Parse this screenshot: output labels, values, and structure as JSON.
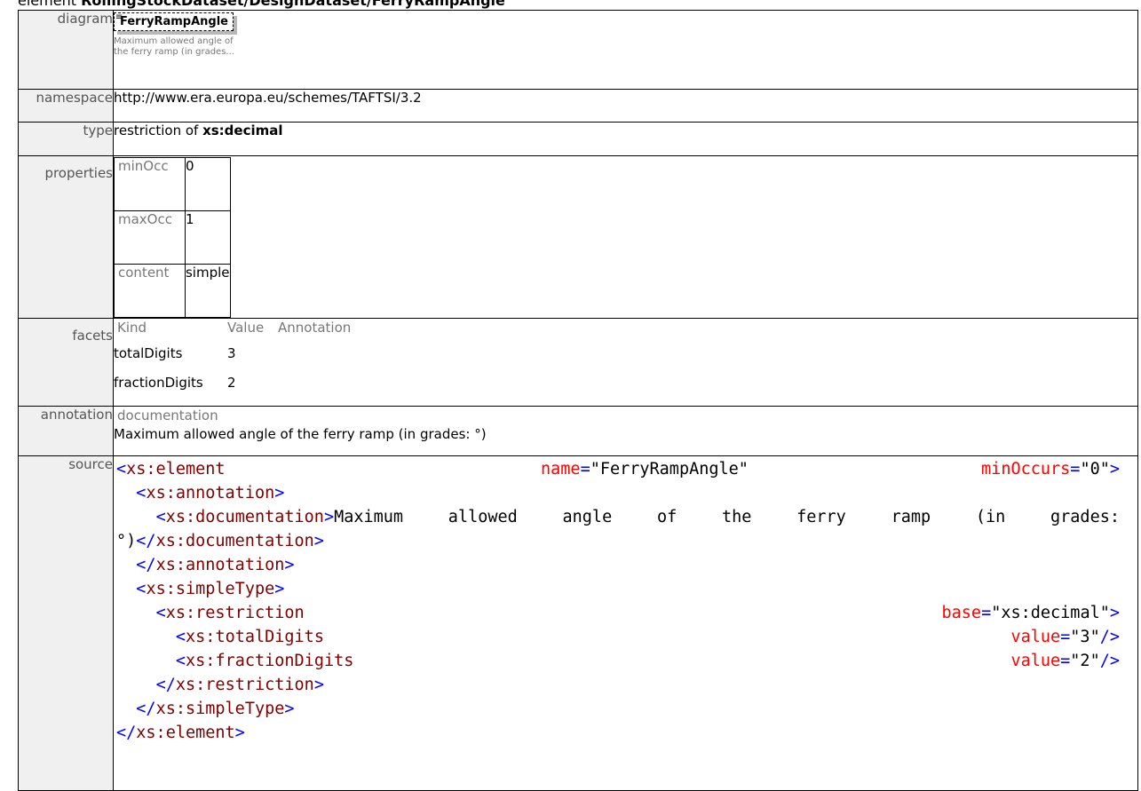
{
  "title": {
    "prefix": "element ",
    "path": "RollingStockDataset/DesignDataset/FerryRampAngle"
  },
  "rows": {
    "diagram": {
      "label": "diagram",
      "element_name": "FerryRampAngle",
      "description": "Maximum allowed angle of the ferry ramp (in grades..."
    },
    "namespace": {
      "label": "namespace",
      "value": "http://www.era.europa.eu/schemes/TAFTSI/3.2"
    },
    "type": {
      "label": "type",
      "prefix": "restriction of ",
      "base": "xs:decimal"
    },
    "properties": {
      "label": "properties",
      "items": [
        {
          "key": "minOcc",
          "value": "0"
        },
        {
          "key": "maxOcc",
          "value": "1"
        },
        {
          "key": "content",
          "value": "simple"
        }
      ]
    },
    "facets": {
      "label": "facets",
      "headers": [
        "Kind",
        "Value",
        "Annotation"
      ],
      "items": [
        {
          "kind": "totalDigits",
          "value": "3"
        },
        {
          "kind": "fractionDigits",
          "value": "2"
        }
      ]
    },
    "annotation": {
      "label": "annotation",
      "heading": "documentation",
      "text": "Maximum allowed angle of the ferry ramp (in grades: °)"
    },
    "source": {
      "label": "source",
      "lines": {
        "l1_tag": "<xs:element",
        "l1_attr1": "name",
        "l1_val1": "\"FerryRampAngle\"",
        "l1_attr2": "minOccurs",
        "l1_val2": "\"0\"",
        "l2": "<xs:annotation>",
        "l3_tag": "<xs:documentation>",
        "l3_text": "Maximum allowed angle of the ferry ramp (in grades:",
        "l4_text": "°)",
        "l4_tag": "</xs:documentation>",
        "l5": "</xs:annotation>",
        "l6": "<xs:simpleType>",
        "l7_tag": "<xs:restriction",
        "l7_attr": "base",
        "l7_val": "\"xs:decimal\"",
        "l8_tag": "<xs:totalDigits",
        "l8_attr": "value",
        "l8_val": "\"3\"",
        "l9_tag": "<xs:fractionDigits",
        "l9_attr": "value",
        "l9_val": "\"2\"",
        "l10": "</xs:restriction>",
        "l11": "</xs:simpleType>",
        "l12": "</xs:element>"
      }
    }
  }
}
